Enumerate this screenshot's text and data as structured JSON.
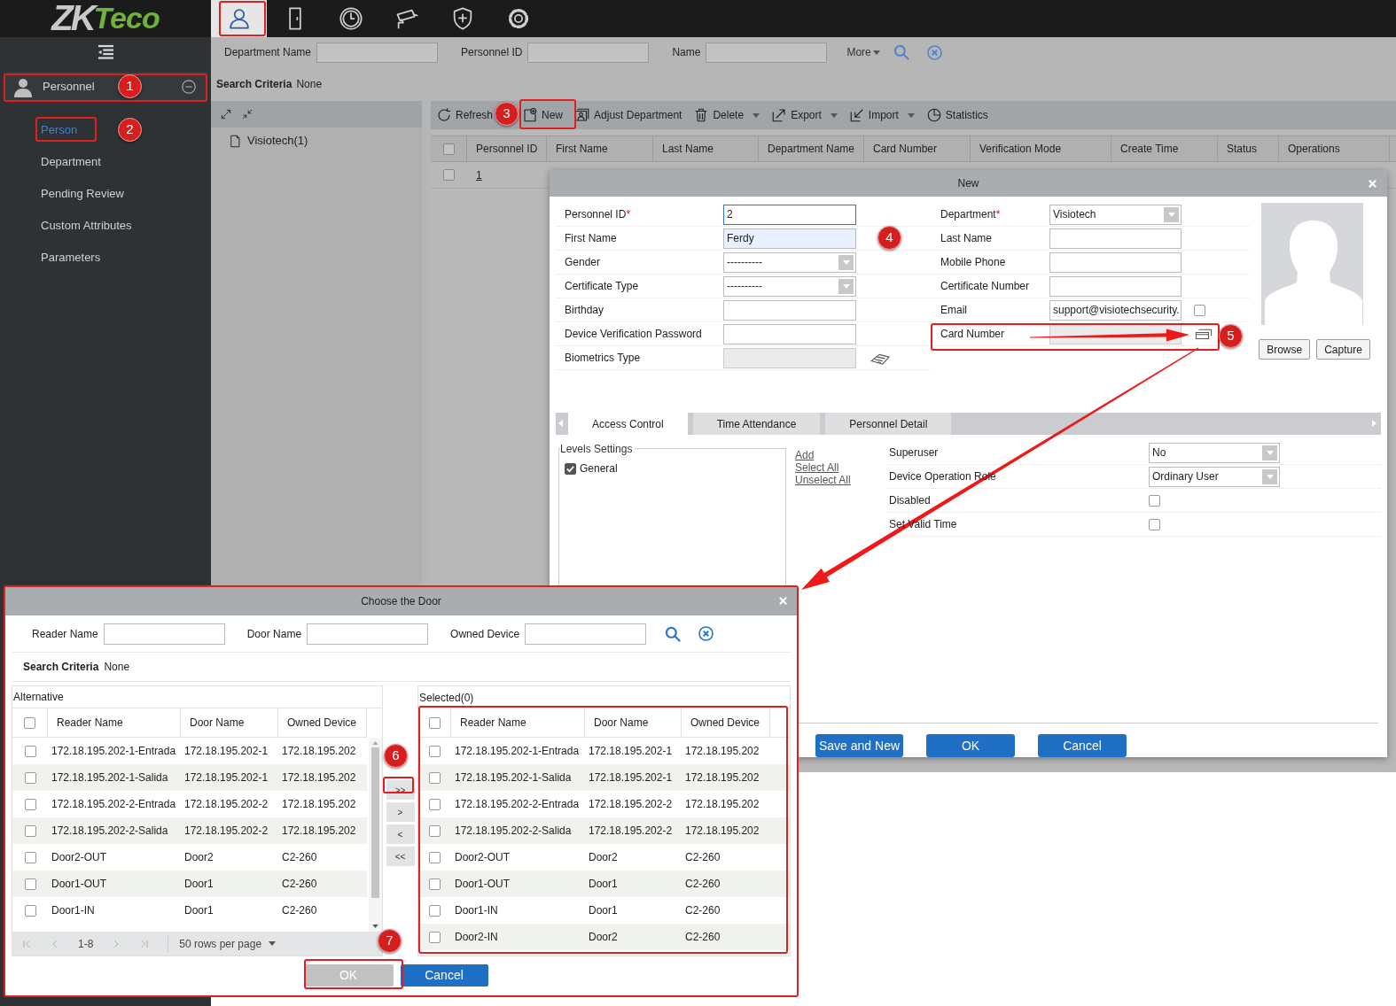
{
  "logo": {
    "part_1": "ZK",
    "part_2": "Teco"
  },
  "nav": [
    {
      "kind": "person",
      "selected": true
    },
    {
      "kind": "door",
      "selected": false
    },
    {
      "kind": "clock",
      "selected": false
    },
    {
      "kind": "camera",
      "selected": false
    },
    {
      "kind": "shield",
      "selected": false
    },
    {
      "kind": "gear",
      "selected": false
    }
  ],
  "sidebar": {
    "module": "Personnel",
    "items": [
      {
        "label": "Person",
        "selected": true
      },
      {
        "label": "Department",
        "selected": false
      },
      {
        "label": "Pending Review",
        "selected": false
      },
      {
        "label": "Custom Attributes",
        "selected": false
      },
      {
        "label": "Parameters",
        "selected": false
      }
    ]
  },
  "search": {
    "fields": [
      {
        "label": "Department Name"
      },
      {
        "label": "Personnel ID"
      },
      {
        "label": "Name"
      }
    ],
    "more": "More",
    "criteria_label": "Search Criteria",
    "criteria_value": "None"
  },
  "tree": {
    "items": [
      {
        "label": "Visiotech(1)"
      }
    ]
  },
  "toolbar": [
    {
      "kind": "refresh",
      "label": "Refresh",
      "dropdown": false
    },
    {
      "kind": "new",
      "label": "New",
      "dropdown": false
    },
    {
      "kind": "adjust",
      "label": "Adjust Department",
      "dropdown": false
    },
    {
      "kind": "delete",
      "label": "Delete",
      "dropdown": true
    },
    {
      "kind": "export",
      "label": "Export",
      "dropdown": true
    },
    {
      "kind": "import",
      "label": "Import",
      "dropdown": true
    },
    {
      "kind": "statistics",
      "label": "Statistics",
      "dropdown": false
    }
  ],
  "table": {
    "columns": [
      "Personnel ID",
      "First Name",
      "Last Name",
      "Department Name",
      "Card Number",
      "Verification Mode",
      "Create Time",
      "Status",
      "Operations"
    ],
    "all_checked": false,
    "rows": [
      {
        "personnel_id": "1",
        "checked": false
      }
    ]
  },
  "new_dialog": {
    "title": "New",
    "left_fields": [
      {
        "label": "Personnel ID",
        "required_mark": "*",
        "kind": "input",
        "value": "2",
        "focused": true,
        "autofilled": false
      },
      {
        "label": "First Name",
        "kind": "input",
        "value": "Ferdy",
        "focused": false,
        "autofilled": true
      },
      {
        "label": "Gender",
        "kind": "select",
        "value": "----------"
      },
      {
        "label": "Certificate Type",
        "kind": "select",
        "value": "----------"
      },
      {
        "label": "Birthday",
        "kind": "input",
        "focused": false,
        "autofilled": false
      },
      {
        "label": "Device Verification Password",
        "kind": "input",
        "focused": false,
        "autofilled": false
      },
      {
        "label": "Biometrics Type",
        "kind": "locked_hand"
      }
    ],
    "right_fields": [
      {
        "label": "Department",
        "required_mark": "*",
        "kind": "select",
        "value": "Visiotech"
      },
      {
        "label": "Last Name",
        "kind": "input",
        "focused": false,
        "autofilled": false
      },
      {
        "label": "Mobile Phone",
        "kind": "input",
        "focused": false,
        "autofilled": false
      },
      {
        "label": "Certificate Number",
        "kind": "input",
        "focused": false,
        "autofilled": false
      },
      {
        "label": "Email",
        "kind": "input_checkbox",
        "value": "support@visiotechsecurity.",
        "focused": false,
        "autofilled": false,
        "checked": false
      },
      {
        "label": "Card Number",
        "kind": "locked_card"
      }
    ],
    "photo_buttons": [
      "Browse",
      "Capture"
    ],
    "tabs": [
      {
        "label": "Access Control",
        "selected": true
      },
      {
        "label": "Time Attendance",
        "selected": false
      },
      {
        "label": "Personnel Detail",
        "selected": false
      }
    ],
    "levels": {
      "title": "Levels Settings",
      "items": [
        {
          "label": "General",
          "checked": true
        }
      ]
    },
    "links": [
      "Add",
      "Select All",
      "Unselect All"
    ],
    "settings": [
      {
        "label": "Superuser",
        "kind": "select",
        "value": "No"
      },
      {
        "label": "Device Operation Role",
        "kind": "select",
        "value": "Ordinary User"
      },
      {
        "label": "Disabled",
        "kind": "checkbox",
        "checked": false
      },
      {
        "label": "Set Valid Time",
        "kind": "checkbox",
        "checked": false
      }
    ],
    "buttons": [
      "Save and New",
      "OK",
      "Cancel"
    ]
  },
  "door_dialog": {
    "title": "Choose the Door",
    "search_fields": [
      {
        "label": "Reader Name"
      },
      {
        "label": "Door Name"
      },
      {
        "label": "Owned Device"
      }
    ],
    "criteria_label": "Search Criteria",
    "criteria_value": "None",
    "alternative": {
      "title": "Alternative",
      "columns": [
        "Reader Name",
        "Door Name",
        "Owned Device"
      ],
      "all_checked": false,
      "rows": [
        {
          "reader": "172.18.195.202-1-Entrada",
          "door": "172.18.195.202-1",
          "device": "172.18.195.202",
          "checked": false
        },
        {
          "reader": "172.18.195.202-1-Salida",
          "door": "172.18.195.202-1",
          "device": "172.18.195.202",
          "checked": false
        },
        {
          "reader": "172.18.195.202-2-Entrada",
          "door": "172.18.195.202-2",
          "device": "172.18.195.202",
          "checked": false
        },
        {
          "reader": "172.18.195.202-2-Salida",
          "door": "172.18.195.202-2",
          "device": "172.18.195.202",
          "checked": false
        },
        {
          "reader": "Door2-OUT",
          "door": "Door2",
          "device": "C2-260",
          "checked": false
        },
        {
          "reader": "Door1-OUT",
          "door": "Door1",
          "device": "C2-260",
          "checked": false
        },
        {
          "reader": "Door1-IN",
          "door": "Door1",
          "device": "C2-260",
          "checked": false
        }
      ]
    },
    "pager": {
      "range": "1-8",
      "rows_per_page": "50 rows per page"
    },
    "move_buttons": [
      ">>",
      ">",
      "<",
      "<<"
    ],
    "selected": {
      "title": "Selected(0)",
      "columns": [
        "Reader Name",
        "Door Name",
        "Owned Device"
      ],
      "all_checked": false,
      "rows": [
        {
          "reader": "172.18.195.202-1-Entrada",
          "door": "172.18.195.202-1",
          "device": "172.18.195.202",
          "checked": false
        },
        {
          "reader": "172.18.195.202-1-Salida",
          "door": "172.18.195.202-1",
          "device": "172.18.195.202",
          "checked": false
        },
        {
          "reader": "172.18.195.202-2-Entrada",
          "door": "172.18.195.202-2",
          "device": "172.18.195.202",
          "checked": false
        },
        {
          "reader": "172.18.195.202-2-Salida",
          "door": "172.18.195.202-2",
          "device": "172.18.195.202",
          "checked": false
        },
        {
          "reader": "Door2-OUT",
          "door": "Door2",
          "device": "C2-260",
          "checked": false
        },
        {
          "reader": "Door1-OUT",
          "door": "Door1",
          "device": "C2-260",
          "checked": false
        },
        {
          "reader": "Door1-IN",
          "door": "Door1",
          "device": "C2-260",
          "checked": false
        },
        {
          "reader": "Door2-IN",
          "door": "Door2",
          "device": "C2-260",
          "checked": false
        }
      ]
    },
    "buttons": [
      {
        "label": "OK",
        "disabled": true
      },
      {
        "label": "Cancel",
        "disabled": false
      }
    ]
  },
  "annotations": [
    {
      "number": "1"
    },
    {
      "number": "2"
    },
    {
      "number": "3"
    },
    {
      "number": "4"
    },
    {
      "number": "5"
    },
    {
      "number": "6"
    },
    {
      "number": "7"
    }
  ]
}
